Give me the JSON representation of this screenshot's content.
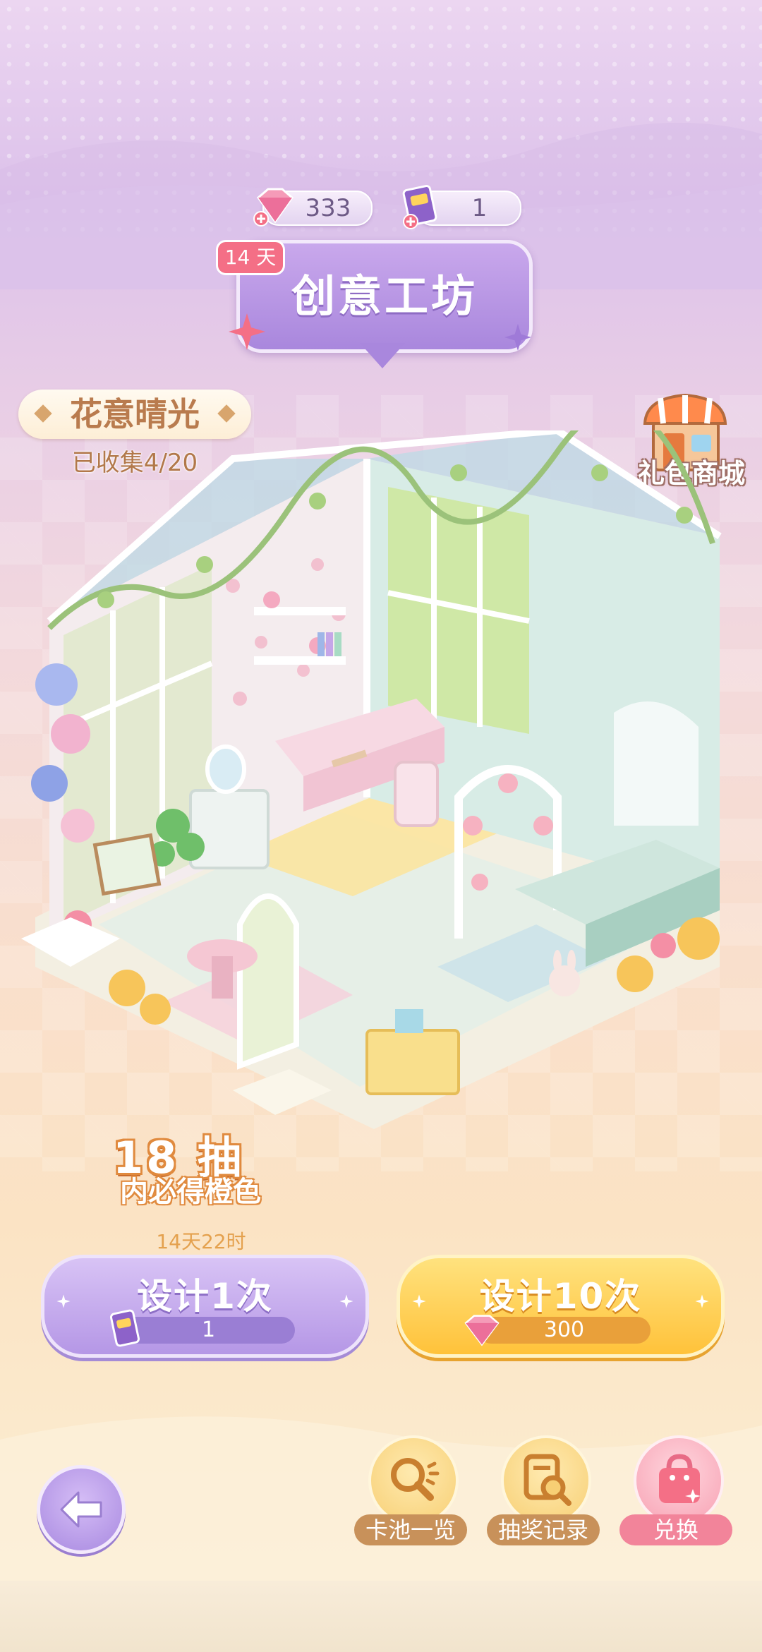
{
  "currency": {
    "diamonds": "333",
    "tickets": "1"
  },
  "banner": {
    "days_badge": "14 天",
    "title": "创意工坊"
  },
  "series": {
    "name": "花意晴光",
    "collected": "已收集4/20"
  },
  "shop": {
    "label": "礼包商城"
  },
  "pity": {
    "count": "18 抽",
    "text": "内必得橙色"
  },
  "timer": "14天22时",
  "draw_once": {
    "label": "设计1次",
    "cost": "1"
  },
  "draw_ten": {
    "label": "设计10次",
    "cost": "300"
  },
  "tools": {
    "pool": "卡池一览",
    "records": "抽奖记录",
    "exchange": "兑换"
  },
  "colors": {
    "purple_accent": "#a987dd",
    "gold_accent": "#ffc23a",
    "pink_accent": "#f46f86"
  }
}
